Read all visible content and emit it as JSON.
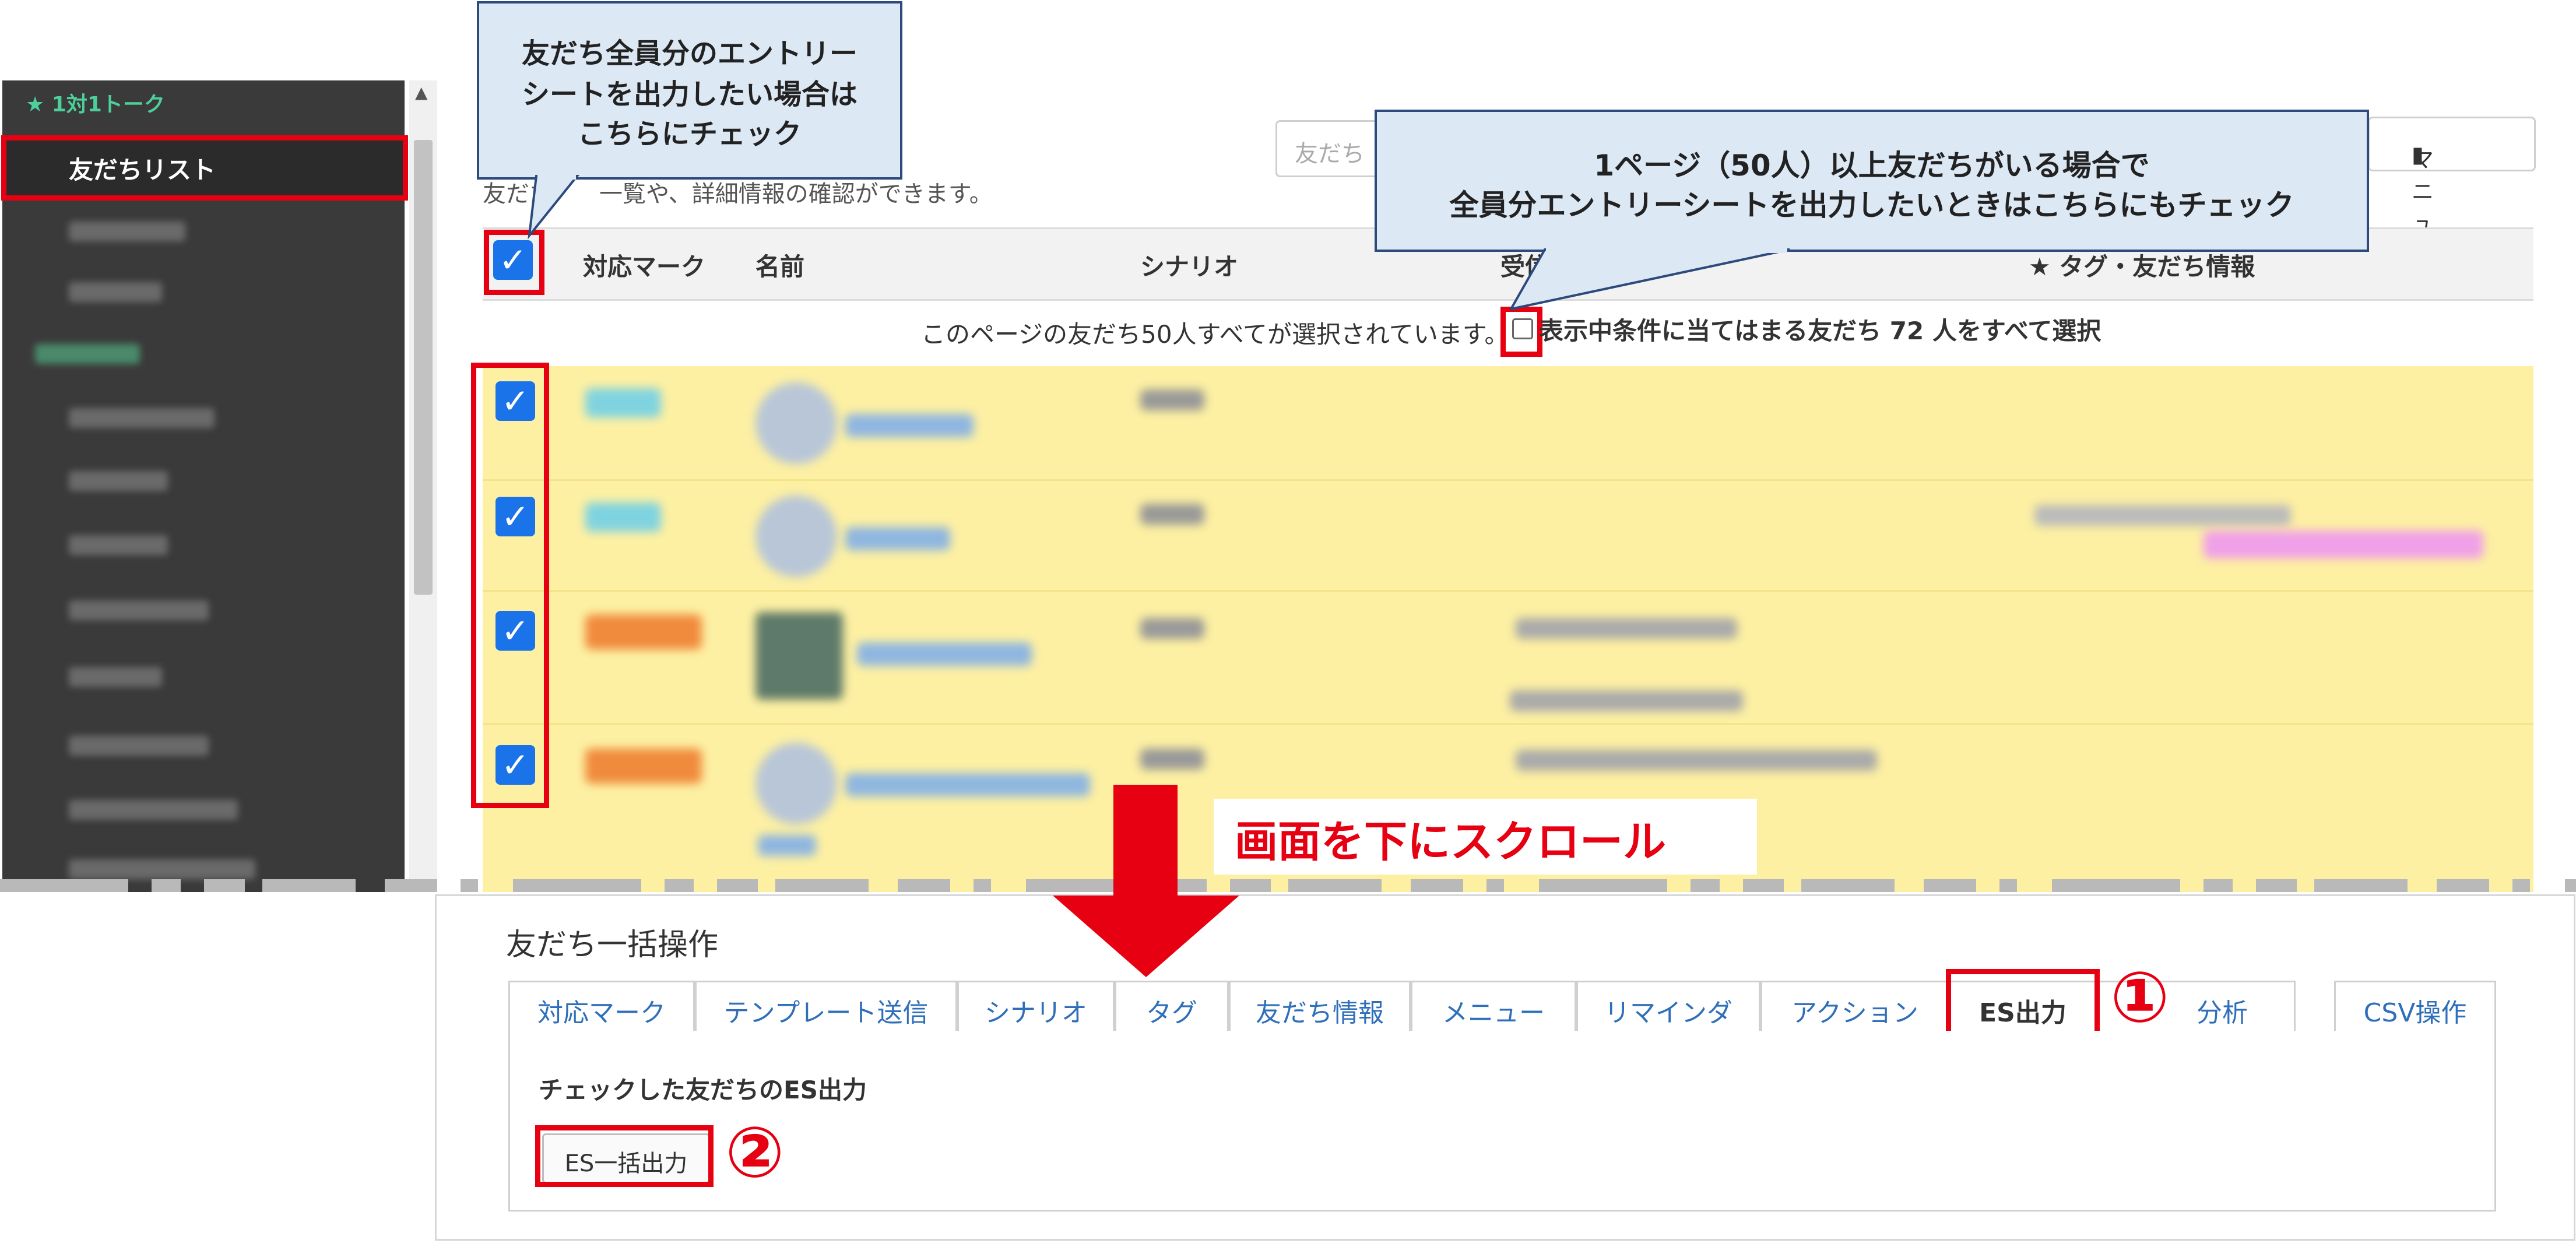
{
  "sidebar": {
    "section_header": "★ 1対1トーク",
    "active_item": "友だちリスト"
  },
  "friends_list": {
    "search_placeholder": "友だち",
    "manual_button": "マニュアル",
    "manual_icon": "book-icon",
    "description": "友だち　　一覧や、詳細情報の確認ができます。",
    "columns": [
      "対応マーク",
      "名前",
      "シナリオ",
      "受信",
      "★ タグ・友だち情報"
    ],
    "selection_banner": "このページの友だち50人すべてが選択されています。",
    "select_all_label": "表示中条件に当てはまる友だち 72 人をすべて選択"
  },
  "callouts": {
    "top_left": [
      "友だち全員分のエントリー",
      "シートを出力したい場合は",
      "こちらにチェック"
    ],
    "top_right": [
      "1ページ（50人）以上友だちがいる場合で",
      "全員分エントリーシートを出力したいときはこちらにもチェック"
    ]
  },
  "scroll_instruction": "画面を下にスクロール",
  "bulk_ops": {
    "title": "友だち一括操作",
    "tabs": [
      "対応マーク",
      "テンプレート送信",
      "シナリオ",
      "タグ",
      "友だち情報",
      "メニュー",
      "リマインダ",
      "アクション",
      "ES出力",
      "分析",
      "CSV操作"
    ],
    "active_tab": "ES出力",
    "section_title": "チェックした友だちのES出力",
    "es_button": "ES一括出力"
  },
  "markers": {
    "step1": "①",
    "step2": "②"
  },
  "colors": {
    "highlight_red": "#e60012",
    "checkbox_blue": "#1a73e8",
    "callout_fill": "#dde8f5",
    "row_yellow": "#fdf0a3",
    "link_blue": "#2f6fba"
  }
}
